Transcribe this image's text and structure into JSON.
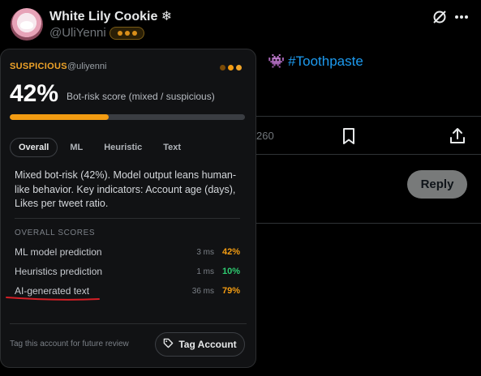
{
  "tweet": {
    "display_name": "White Lily Cookie ❄",
    "handle": "@UliYenni",
    "body_hashtag": "#Toothpaste",
    "body_prefix_emoji": "👾",
    "metric_count": "260",
    "reply_label": "Reply"
  },
  "panel": {
    "status_label": "SUSPICIOUS",
    "handle": "@uliyenni",
    "score_pct": "42%",
    "score_value": 0.42,
    "score_description": "Bot-risk score (mixed / suspicious)",
    "tabs": [
      {
        "label": "Overall",
        "active": true
      },
      {
        "label": "ML",
        "active": false
      },
      {
        "label": "Heuristic",
        "active": false
      },
      {
        "label": "Text",
        "active": false
      }
    ],
    "summary": "Mixed bot-risk (42%). Model output leans human-like behavior. Key indicators: Account age (days), Likes per tweet ratio.",
    "section_title": "OVERALL SCORES",
    "scores": [
      {
        "label": "ML model prediction",
        "ms": "3 ms",
        "pct": "42%",
        "color": "#f39c12"
      },
      {
        "label": "Heuristics prediction",
        "ms": "1 ms",
        "pct": "10%",
        "color": "#2ecc71"
      },
      {
        "label": "AI-generated text",
        "ms": "36 ms",
        "pct": "79%",
        "color": "#f39c12"
      }
    ],
    "footer_note": "Tag this account for future review",
    "tag_button": "Tag Account",
    "dot_colors": [
      "#7a4a06",
      "#f39c12",
      "#f0a429"
    ]
  },
  "colors": {
    "warning": "#f39c12",
    "success": "#2ecc71",
    "link": "#1d9bf0",
    "annotation": "#d41f26"
  }
}
